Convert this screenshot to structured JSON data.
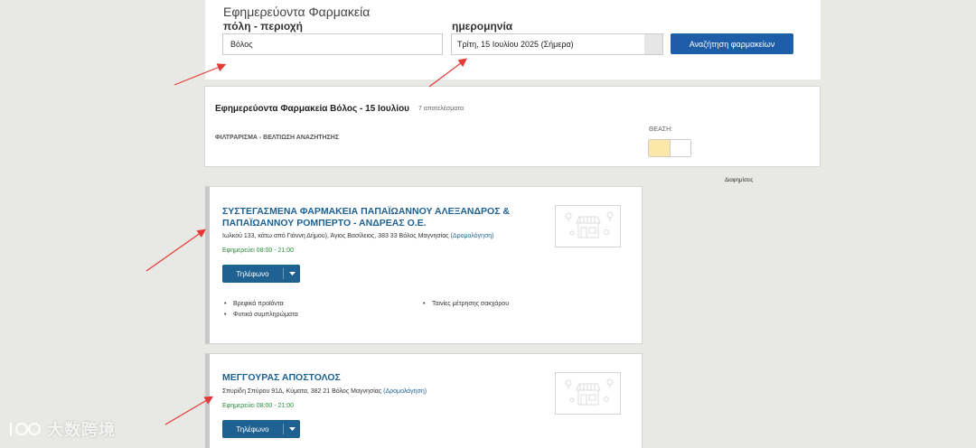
{
  "search": {
    "title": "Εφημερεύοντα Φαρμακεία",
    "city_label": "πόλη - περιοχή",
    "city_value": "Βόλος",
    "date_label": "ημερομηνία",
    "date_value": "Τρίτη, 15 Ιουλίου 2025 (Σήμερα)",
    "button_label": "Αναζήτηση φαρμακείων"
  },
  "results": {
    "title": "Εφημερεύοντα Φαρμακεία Βόλος - 15 Ιουλίου",
    "count": "7 αποτελέσματα",
    "filter_label": "ΦΙΛΤΡΑΡΙΣΜΑ - ΒΕΛΤΙΩΣΗ ΑΝΑΖΗΤΗΣΗΣ",
    "view_label": "ΘΕΑΣΗ:"
  },
  "ad_label": "Διαφημίσεις",
  "pharmacies": [
    {
      "name": "ΣΥΣΤΕΓΑΣΜΕΝΑ ΦΑΡΜΑΚΕΙΑ ΠΑΠΑΪΩΑΝΝΟΥ ΑΛΕΞΑΝΔΡΟΣ & ΠΑΠΑΪΩΑΝΝΟΥ ΡΟΜΠΕΡΤΟ - ΑΝΔΡΕΑΣ Ο.Ε.",
      "address": "Ιωλκού 133, κάτω από Γιάννη Δήμου), Άγιος Βασίλειος, 383 33 Βόλος Μαγνησίας",
      "route_link": "(Δρομολόγηση)",
      "hours": "Εφημερεύει 08:00 - 21:00",
      "phone_label": "Τηλέφωνο",
      "features": [
        "Βρεφικά προϊόντα",
        "Φυτικά συμπληρώματα",
        "Ταινίες μέτρησης σακχάρου"
      ]
    },
    {
      "name": "ΜΕΓΓΟΥΡΑΣ ΑΠΟΣΤΟΛΟΣ",
      "address": "Σπυρίδη Σπύρου 91Δ, Κύματα, 382 21 Βόλος Μαγνησίας",
      "route_link": "(Δρομολόγηση)",
      "hours": "Εφημερεύει 08:00 - 21:00",
      "phone_label": "Τηλέφωνο"
    }
  ],
  "watermark": "大数跨境",
  "colors": {
    "primary_button": "#1e5ea8",
    "link": "#1f6191",
    "hours": "#2b8a3e",
    "annotation_arrow": "#e53935",
    "view_active": "#fbe7a7"
  }
}
